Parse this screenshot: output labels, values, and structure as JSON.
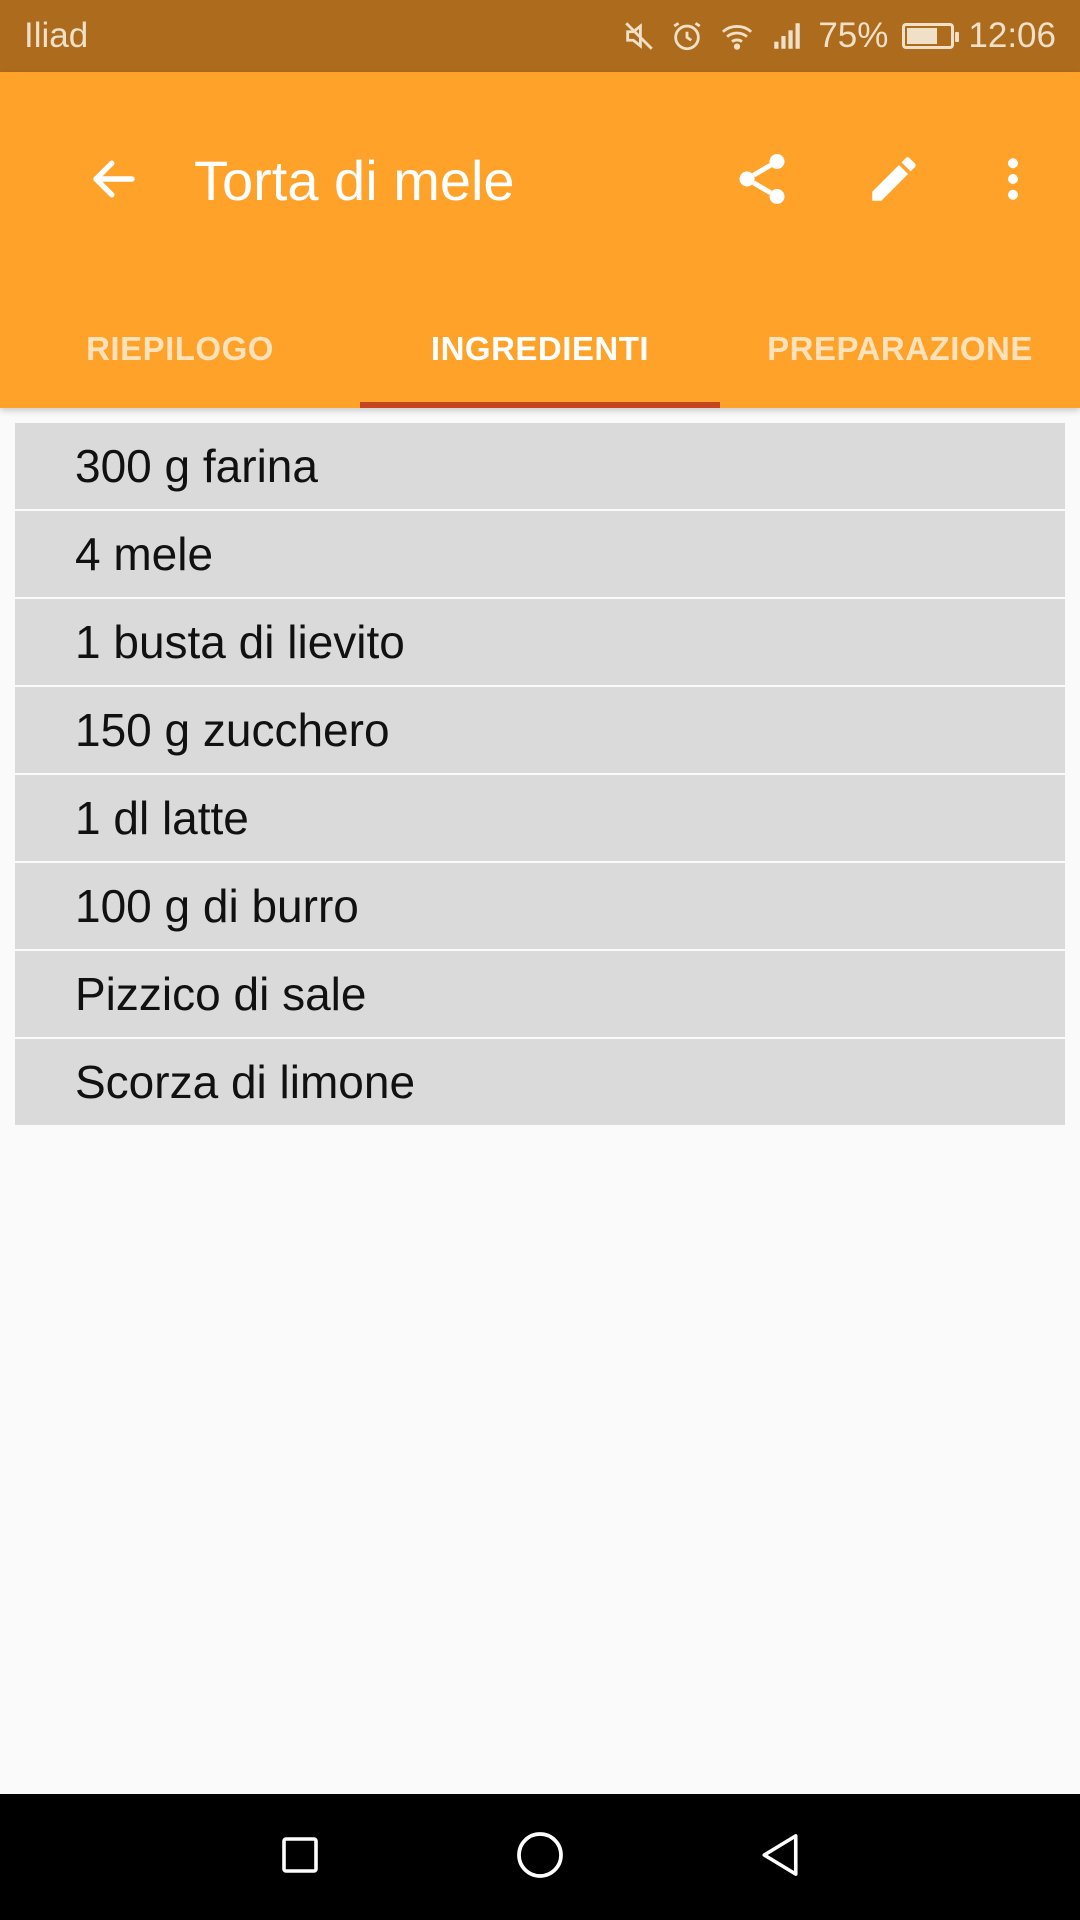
{
  "status_bar": {
    "carrier": "Iliad",
    "battery_percent": "75%",
    "battery_level": 0.75,
    "time": "12:06",
    "icons": [
      "mute-icon",
      "alarm-icon",
      "wifi-icon",
      "signal-icon",
      "battery-icon"
    ]
  },
  "toolbar": {
    "title": "Torta di mele",
    "icons": [
      "back-arrow-icon",
      "share-icon",
      "edit-pencil-icon",
      "more-vert-icon"
    ]
  },
  "tabs": [
    {
      "label": "RIEPILOGO",
      "active": false
    },
    {
      "label": "INGREDIENTI",
      "active": true
    },
    {
      "label": "PREPARAZIONE",
      "active": false
    }
  ],
  "ingredients": [
    "300 g farina",
    "4 mele",
    "1 busta di lievito",
    "150 g zucchero",
    "1 dl latte",
    "100 g di burro",
    "Pizzico di sale",
    "Scorza di limone"
  ],
  "nav_bar": {
    "icons": [
      "recent-apps-icon",
      "home-icon",
      "back-icon"
    ]
  },
  "colors": {
    "status_bar": "#ad6b1d",
    "app_bar": "#ffa22a",
    "tab_indicator": "#c3461f",
    "list_item": "#dadada",
    "background": "#fafafa"
  }
}
